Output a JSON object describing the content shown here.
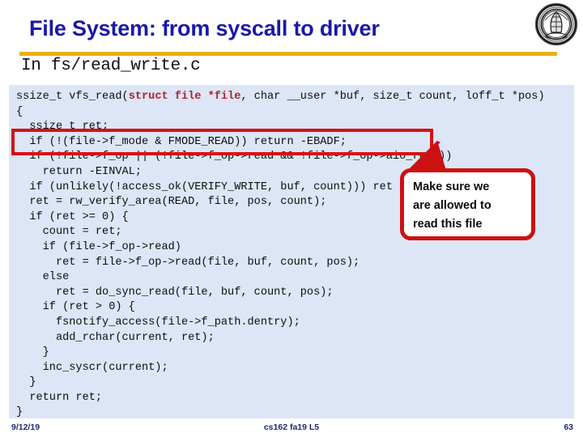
{
  "slide": {
    "title": "File System: from syscall to driver",
    "subtitle": "In fs/read_write.c",
    "logo_name": "uc-berkeley-seal"
  },
  "code": {
    "language": "c",
    "signature_prefix": "ssize_t vfs_read(",
    "signature_keyword": "struct file *file",
    "signature_suffix": ", char __user *buf, size_t count, loff_t *pos)",
    "body": "{\n  ssize_t ret;\n  if (!(file->f_mode & FMODE_READ)) return -EBADF;\n  if (!file->f_op || (!file->f_op->read && !file->f_op->aio_read))\n    return -EINVAL;\n  if (unlikely(!access_ok(VERIFY_WRITE, buf, count))) ret = -EFAULT;\n  ret = rw_verify_area(READ, file, pos, count);\n  if (ret >= 0) {\n    count = ret;\n    if (file->f_op->read)\n      ret = file->f_op->read(file, buf, count, pos);\n    else\n      ret = do_sync_read(file, buf, count, pos);\n    if (ret > 0) {\n      fsnotify_access(file->f_path.dentry);\n      add_rchar(current, ret);\n    }\n    inc_syscr(current);\n  }\n  return ret;\n}"
  },
  "annotations": {
    "highlight_line": "if (!(file->f_mode & FMODE_READ)) return -EBADF;",
    "callout_text": "Make sure we\nare allowed to\nread this file",
    "accent_red": "#cc1111",
    "accent_gold": "#e8b011",
    "title_blue": "#1a18a8",
    "code_bg": "#dce6f7"
  },
  "footer": {
    "date": "9/12/19",
    "center": "cs162 fa19 L5",
    "page": "63"
  }
}
